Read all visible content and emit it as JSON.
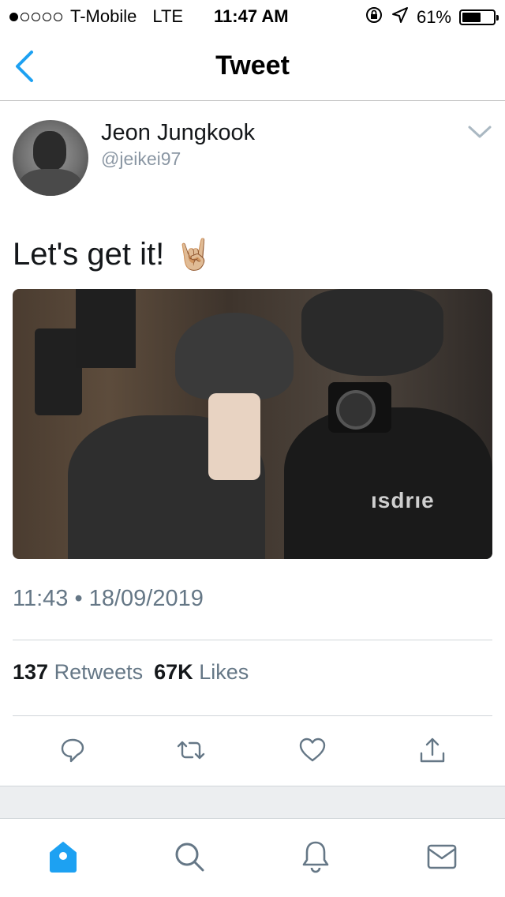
{
  "status_bar": {
    "carrier": "T-Mobile",
    "network": "LTE",
    "time": "11:47 AM",
    "battery_percent": "61%",
    "battery_level": 0.61,
    "signal_bars_filled": 1,
    "signal_bars_total": 5
  },
  "nav": {
    "title": "Tweet",
    "back_icon": "chevron-left-icon",
    "accent_color": "#1da1f2"
  },
  "tweet": {
    "user_name": "Jeon Jungkook",
    "user_handle": "@jeikei97",
    "text": "Let's get it!",
    "emoji": "🤘🏼",
    "photo_text": "ısdrıe",
    "timestamp": "11:43 • 18/09/2019",
    "retweets_count": "137",
    "retweets_label": "Retweets",
    "likes_count": "67K",
    "likes_label": "Likes"
  },
  "actions": [
    {
      "name": "reply",
      "icon": "reply-icon"
    },
    {
      "name": "retweet",
      "icon": "retweet-icon"
    },
    {
      "name": "like",
      "icon": "heart-icon"
    },
    {
      "name": "share",
      "icon": "share-icon"
    }
  ],
  "tab_bar": [
    {
      "name": "home",
      "icon": "home-icon",
      "active": true
    },
    {
      "name": "search",
      "icon": "search-icon",
      "active": false
    },
    {
      "name": "notifications",
      "icon": "bell-icon",
      "active": false
    },
    {
      "name": "messages",
      "icon": "mail-icon",
      "active": false
    }
  ],
  "colors": {
    "accent": "#1da1f2",
    "secondary_text": "#657786",
    "icon_gray": "#657786"
  }
}
